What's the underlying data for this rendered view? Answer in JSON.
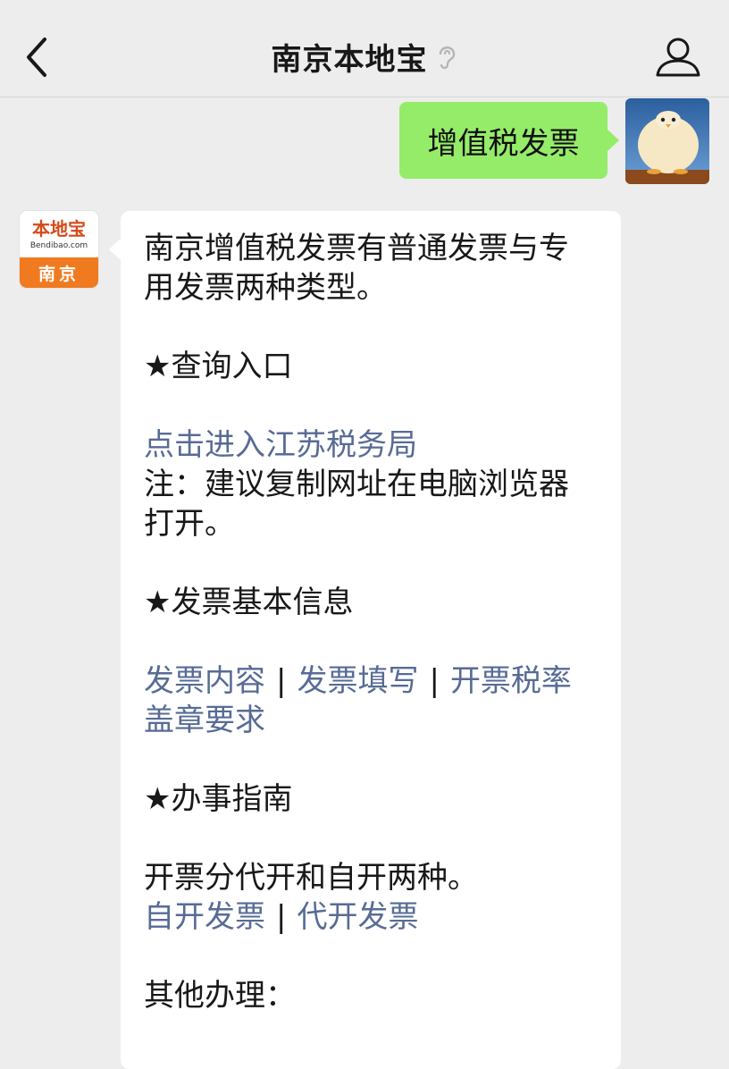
{
  "header": {
    "title": "南京本地宝"
  },
  "user_message": {
    "text": "增值税发票"
  },
  "bot_logo": {
    "brand": "本地宝",
    "domain": "Bendibao.com",
    "city": "南京"
  },
  "reply": {
    "intro_1": "南京增值税发票有普通发票与专",
    "intro_2": "用发票两种类型。",
    "section_query": "★查询入口",
    "link_tax_bureau": "点击进入江苏税务局",
    "note_1": "注：建议复制网址在电脑浏览器",
    "note_2": "打开。",
    "section_basic": "★发票基本信息",
    "basic_links": [
      "发票内容",
      "发票填写",
      "开票税率",
      "盖章要求"
    ],
    "separator": "|",
    "section_guide": "★办事指南",
    "guide_text": "开票分代开和自开两种。",
    "guide_links": [
      "自开发票",
      "代开发票"
    ],
    "other": "其他办理："
  },
  "colors": {
    "background": "#ededed",
    "user_bubble": "#95ec69",
    "link": "#576b95",
    "logo_orange": "#f07a20"
  },
  "icons": [
    "back-chevron-icon",
    "ear-icon",
    "user-profile-icon"
  ]
}
